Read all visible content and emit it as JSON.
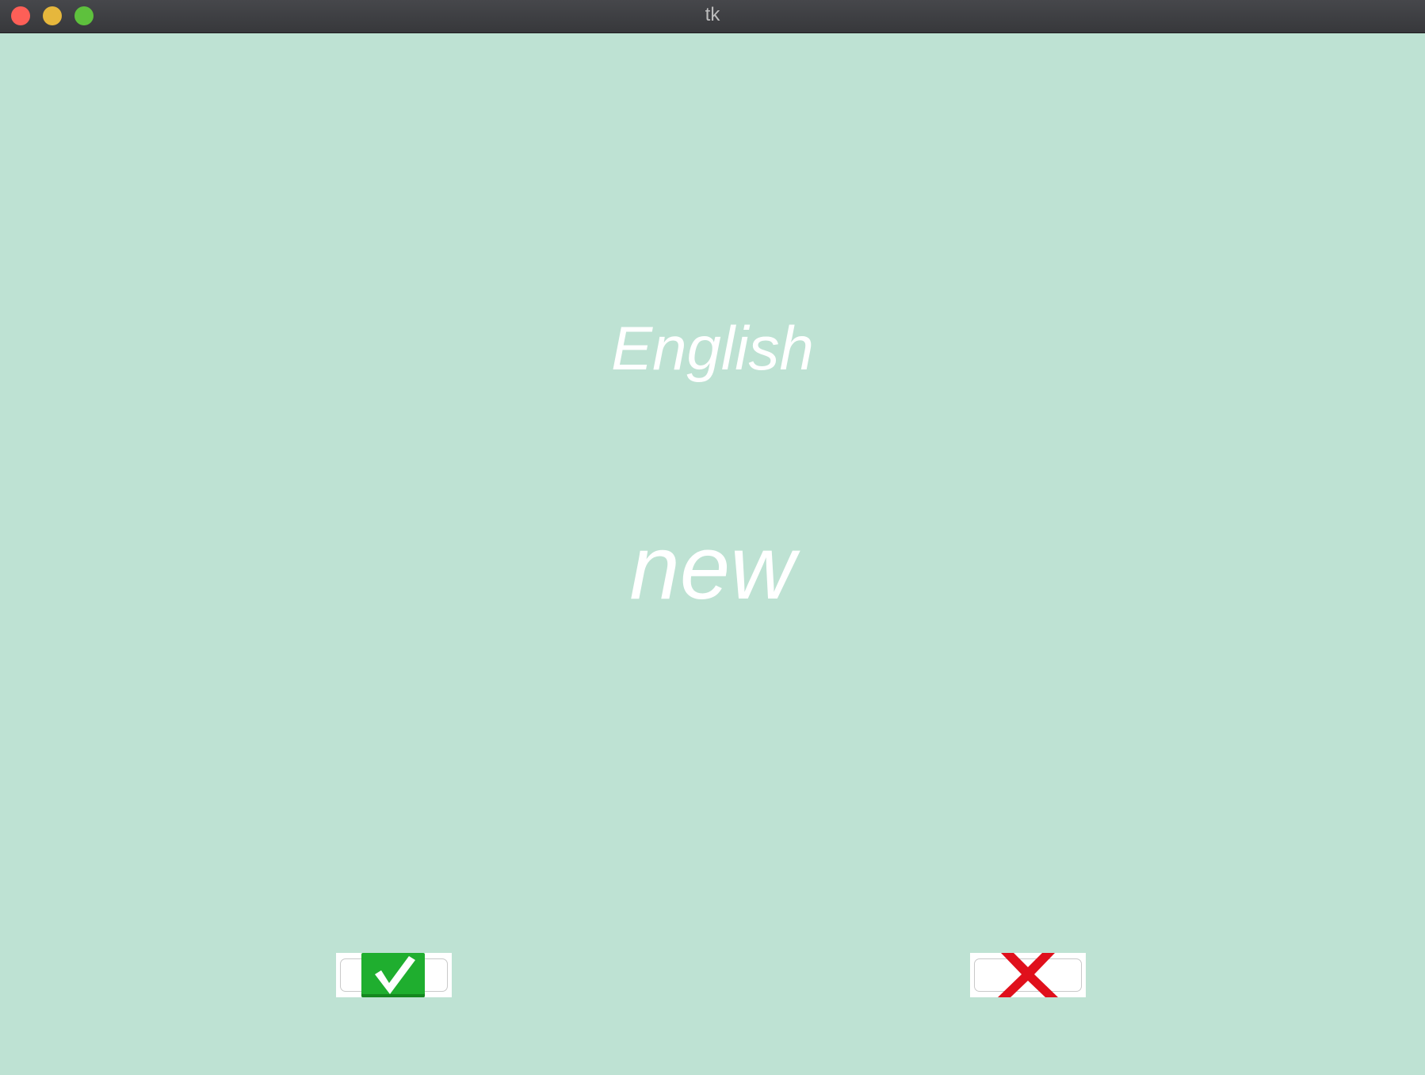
{
  "window": {
    "title": "tk",
    "background_color": "#bee2d3"
  },
  "flashcard": {
    "language": "English",
    "word": "new",
    "text_color": "#ffffff"
  },
  "buttons": {
    "correct": {
      "icon": "check-mark-icon",
      "color": "#1fae2f"
    },
    "wrong": {
      "icon": "cross-mark-icon",
      "color": "#e0101c"
    }
  }
}
